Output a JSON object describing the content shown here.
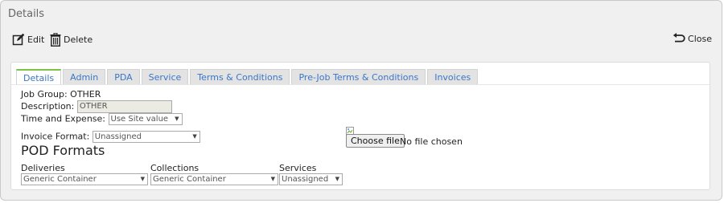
{
  "panel": {
    "title": "Details"
  },
  "toolbar": {
    "edit_label": "Edit",
    "delete_label": "Delete",
    "close_label": "Close"
  },
  "tabs": [
    {
      "label": "Details",
      "active": true
    },
    {
      "label": "Admin"
    },
    {
      "label": "PDA"
    },
    {
      "label": "Service"
    },
    {
      "label": "Terms & Conditions"
    },
    {
      "label": "Pre-Job Terms & Conditions"
    },
    {
      "label": "Invoices"
    }
  ],
  "details": {
    "job_group_label": "Job Group:",
    "job_group_value": "OTHER",
    "description_label": "Description:",
    "description_value": "OTHER",
    "time_expense_label": "Time and Expense:",
    "time_expense_value": "Use Site value",
    "invoice_format_label": "Invoice Format:",
    "invoice_format_value": "Unassigned",
    "file_button_label": "Choose file",
    "file_status": "No file chosen"
  },
  "pod": {
    "heading": "POD Formats",
    "deliveries_label": "Deliveries",
    "deliveries_value": "Generic Container",
    "collections_label": "Collections",
    "collections_value": "Generic Container",
    "services_label": "Services",
    "services_value": "Unassigned"
  },
  "colors": {
    "tab_link": "#3b76c4",
    "active_tab_accent": "#7cc243",
    "panel_bg": "#f0f0f0"
  }
}
